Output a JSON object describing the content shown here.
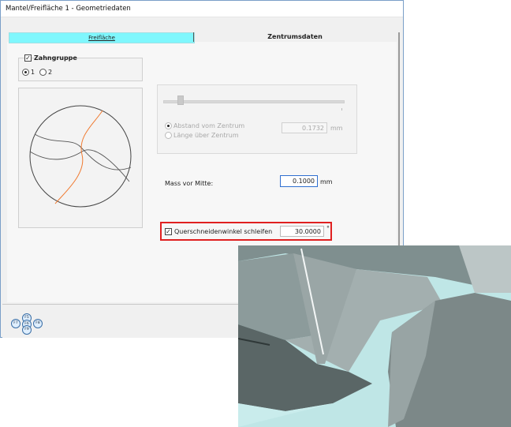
{
  "window": {
    "title": "Mantel/Freifläche 1 - Geometriedaten"
  },
  "tabs": [
    {
      "label": "Freifläche"
    },
    {
      "label": "Zentrumsdaten"
    }
  ],
  "tooth_group": {
    "checkbox_label": "Zahngruppe",
    "checked": true,
    "radio_options": [
      "1",
      "2"
    ],
    "selected": "1"
  },
  "distance_group": {
    "radio_from_center": "Abstand vom Zentrum",
    "radio_length_over_center": "Länge über Zentrum",
    "value": "0.1732",
    "unit": "mm",
    "enabled": false
  },
  "mass_from_center": {
    "label": "Mass vor Mitte:",
    "value": "0.1000",
    "unit": "mm"
  },
  "chisel_edge": {
    "label": "Querschneidenwinkel schleifen",
    "checked": true,
    "value": "30.0000",
    "unit": "°"
  },
  "nav_keys": {
    "up": "F5",
    "left": "F7",
    "center": "F6",
    "right": "F8",
    "down": "F9"
  },
  "colors": {
    "tab_active": "#7ff7fd",
    "highlight": "#e02020",
    "curve": "#f07a30",
    "render_bg": "#bfe6e6"
  }
}
